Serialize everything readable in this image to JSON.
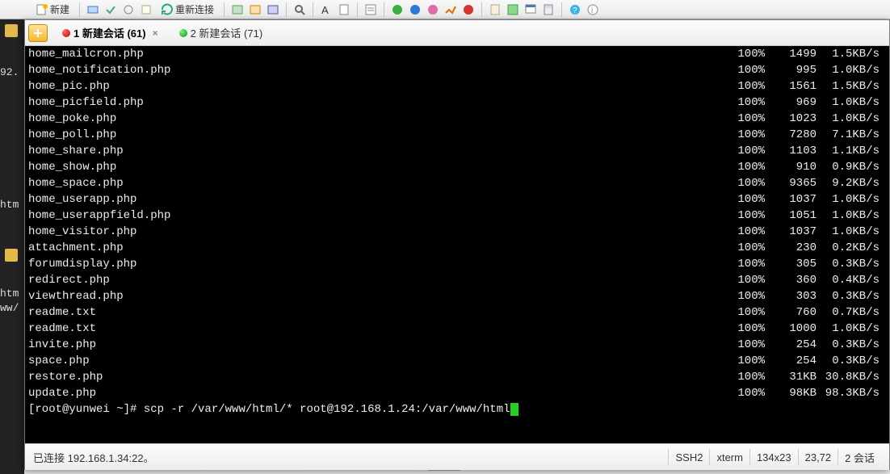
{
  "toolbar": {
    "new_label": "新建",
    "reconnect_label": "重新连接"
  },
  "tabs": [
    {
      "label": "1 新建会话 (61)",
      "status": "red",
      "active": true
    },
    {
      "label": "2 新建会话 (71)",
      "status": "green",
      "active": false
    }
  ],
  "terminal": {
    "rows": [
      {
        "name": "home_mailcron.php",
        "pct": "100%",
        "size": "1499",
        "rate": "1.5KB/s"
      },
      {
        "name": "home_notification.php",
        "pct": "100%",
        "size": "995",
        "rate": "1.0KB/s"
      },
      {
        "name": "home_pic.php",
        "pct": "100%",
        "size": "1561",
        "rate": "1.5KB/s"
      },
      {
        "name": "home_picfield.php",
        "pct": "100%",
        "size": "969",
        "rate": "1.0KB/s"
      },
      {
        "name": "home_poke.php",
        "pct": "100%",
        "size": "1023",
        "rate": "1.0KB/s"
      },
      {
        "name": "home_poll.php",
        "pct": "100%",
        "size": "7280",
        "rate": "7.1KB/s"
      },
      {
        "name": "home_share.php",
        "pct": "100%",
        "size": "1103",
        "rate": "1.1KB/s"
      },
      {
        "name": "home_show.php",
        "pct": "100%",
        "size": "910",
        "rate": "0.9KB/s"
      },
      {
        "name": "home_space.php",
        "pct": "100%",
        "size": "9365",
        "rate": "9.2KB/s"
      },
      {
        "name": "home_userapp.php",
        "pct": "100%",
        "size": "1037",
        "rate": "1.0KB/s"
      },
      {
        "name": "home_userappfield.php",
        "pct": "100%",
        "size": "1051",
        "rate": "1.0KB/s"
      },
      {
        "name": "home_visitor.php",
        "pct": "100%",
        "size": "1037",
        "rate": "1.0KB/s"
      },
      {
        "name": "attachment.php",
        "pct": "100%",
        "size": "230",
        "rate": "0.2KB/s"
      },
      {
        "name": "forumdisplay.php",
        "pct": "100%",
        "size": "305",
        "rate": "0.3KB/s"
      },
      {
        "name": "redirect.php",
        "pct": "100%",
        "size": "360",
        "rate": "0.4KB/s"
      },
      {
        "name": "viewthread.php",
        "pct": "100%",
        "size": "303",
        "rate": "0.3KB/s"
      },
      {
        "name": "readme.txt",
        "pct": "100%",
        "size": "760",
        "rate": "0.7KB/s"
      },
      {
        "name": "readme.txt",
        "pct": "100%",
        "size": "1000",
        "rate": "1.0KB/s"
      },
      {
        "name": "invite.php",
        "pct": "100%",
        "size": "254",
        "rate": "0.3KB/s"
      },
      {
        "name": "space.php",
        "pct": "100%",
        "size": "254",
        "rate": "0.3KB/s"
      },
      {
        "name": "restore.php",
        "pct": "100%",
        "size": "31KB",
        "rate": "30.8KB/s"
      },
      {
        "name": "update.php",
        "pct": "100%",
        "size": "98KB",
        "rate": "98.3KB/s"
      }
    ],
    "prompt": "[root@yunwei ~]# scp -r /var/www/html/* root@192.168.1.24:/var/www/html"
  },
  "statusbar": {
    "connected": "已连接 192.168.1.34:22。",
    "proto": "SSH2",
    "term": "xterm",
    "size": "134x23",
    "pos": "23,72",
    "sess": "2 会话"
  },
  "left_strip": {
    "ip_fragment": "92.",
    "htm1": "htm",
    "htm2": "htm",
    "ww": "ww/"
  }
}
